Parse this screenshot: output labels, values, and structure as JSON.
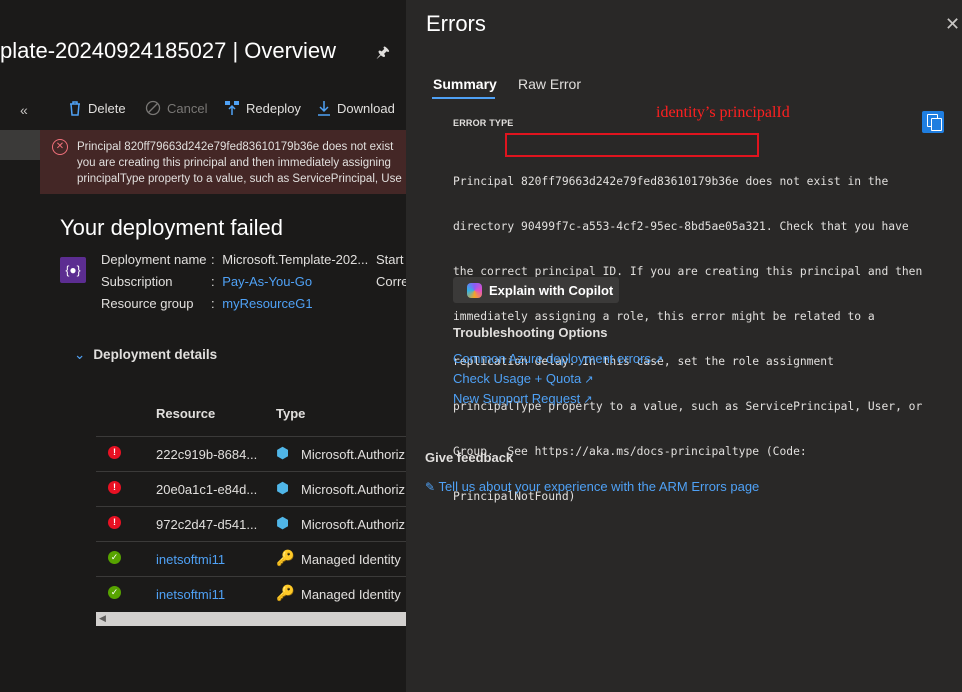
{
  "page": {
    "title": "plate-20240924185027 | Overview"
  },
  "toolbar": {
    "collapse": "«",
    "delete_label": "Delete",
    "cancel_label": "Cancel",
    "redeploy_label": "Redeploy",
    "download_label": "Download"
  },
  "banner": {
    "line1": "Principal 820ff79663d242e79fed83610179b36e does not exist",
    "line2": "you are creating this principal and then immediately assigning",
    "line3": "principalType property to a value, such as ServicePrincipal, Use"
  },
  "deployment": {
    "heading": "Your deployment failed",
    "name_label": "Deployment name",
    "name_value": "Microsoft.Template-202...",
    "sub_label": "Subscription",
    "sub_value": "Pay-As-You-Go",
    "rg_label": "Resource group",
    "rg_value": "myResourceG1",
    "start_label": "Start",
    "corr_label": "Corre",
    "colon": ":"
  },
  "details": {
    "heading": "Deployment details",
    "col_resource": "Resource",
    "col_type": "Type",
    "rows": [
      {
        "status": "error",
        "resource": "222c919b-8684...",
        "type": "Microsoft.Authoriz"
      },
      {
        "status": "error",
        "resource": "20e0a1c1-e84d...",
        "type": "Microsoft.Authoriz"
      },
      {
        "status": "error",
        "resource": "972c2d47-d541...",
        "type": "Microsoft.Authoriz"
      },
      {
        "status": "ok",
        "resource": "inetsoftmi11",
        "type": "Managed Identity"
      },
      {
        "status": "ok",
        "resource": "inetsoftmi11",
        "type": "Managed Identity"
      }
    ]
  },
  "panel": {
    "title": "Errors",
    "close": "✕",
    "tab_summary": "Summary",
    "tab_raw": "Raw Error",
    "error_type_label": "ERROR TYPE",
    "annotation": "identity’s principalId",
    "message_lines": [
      "Principal 820ff79663d242e79fed83610179b36e does not exist in the",
      "directory 90499f7c-a553-4cf2-95ec-8bd5ae05a321. Check that you have",
      "the correct principal ID. If you are creating this principal and then",
      "immediately assigning a role, this error might be related to a",
      "replication delay. In this case, set the role assignment",
      "principalType property to a value, such as ServicePrincipal, User, or",
      "Group.  See https://aka.ms/docs-principaltype (Code:",
      "PrincipalNotFound)"
    ],
    "copilot_label": "Explain with Copilot",
    "troubleshooting_heading": "Troubleshooting Options",
    "link1": "Common Azure deployment errors",
    "link2": "Check Usage + Quota",
    "link3": "New Support Request",
    "feedback_heading": "Give feedback",
    "feedback_link": "Tell us about your experience with the ARM Errors page"
  },
  "icons": {
    "pin": "pin-icon",
    "delete": "trash-icon",
    "cancel": "cancel-icon",
    "redeploy": "redeploy-icon",
    "download": "download-icon",
    "copy": "copy-icon",
    "external": "external-link-icon"
  },
  "colors": {
    "accent": "#4fa1f5",
    "error": "#e81123",
    "success": "#57a300",
    "annotation": "#ff2020"
  }
}
